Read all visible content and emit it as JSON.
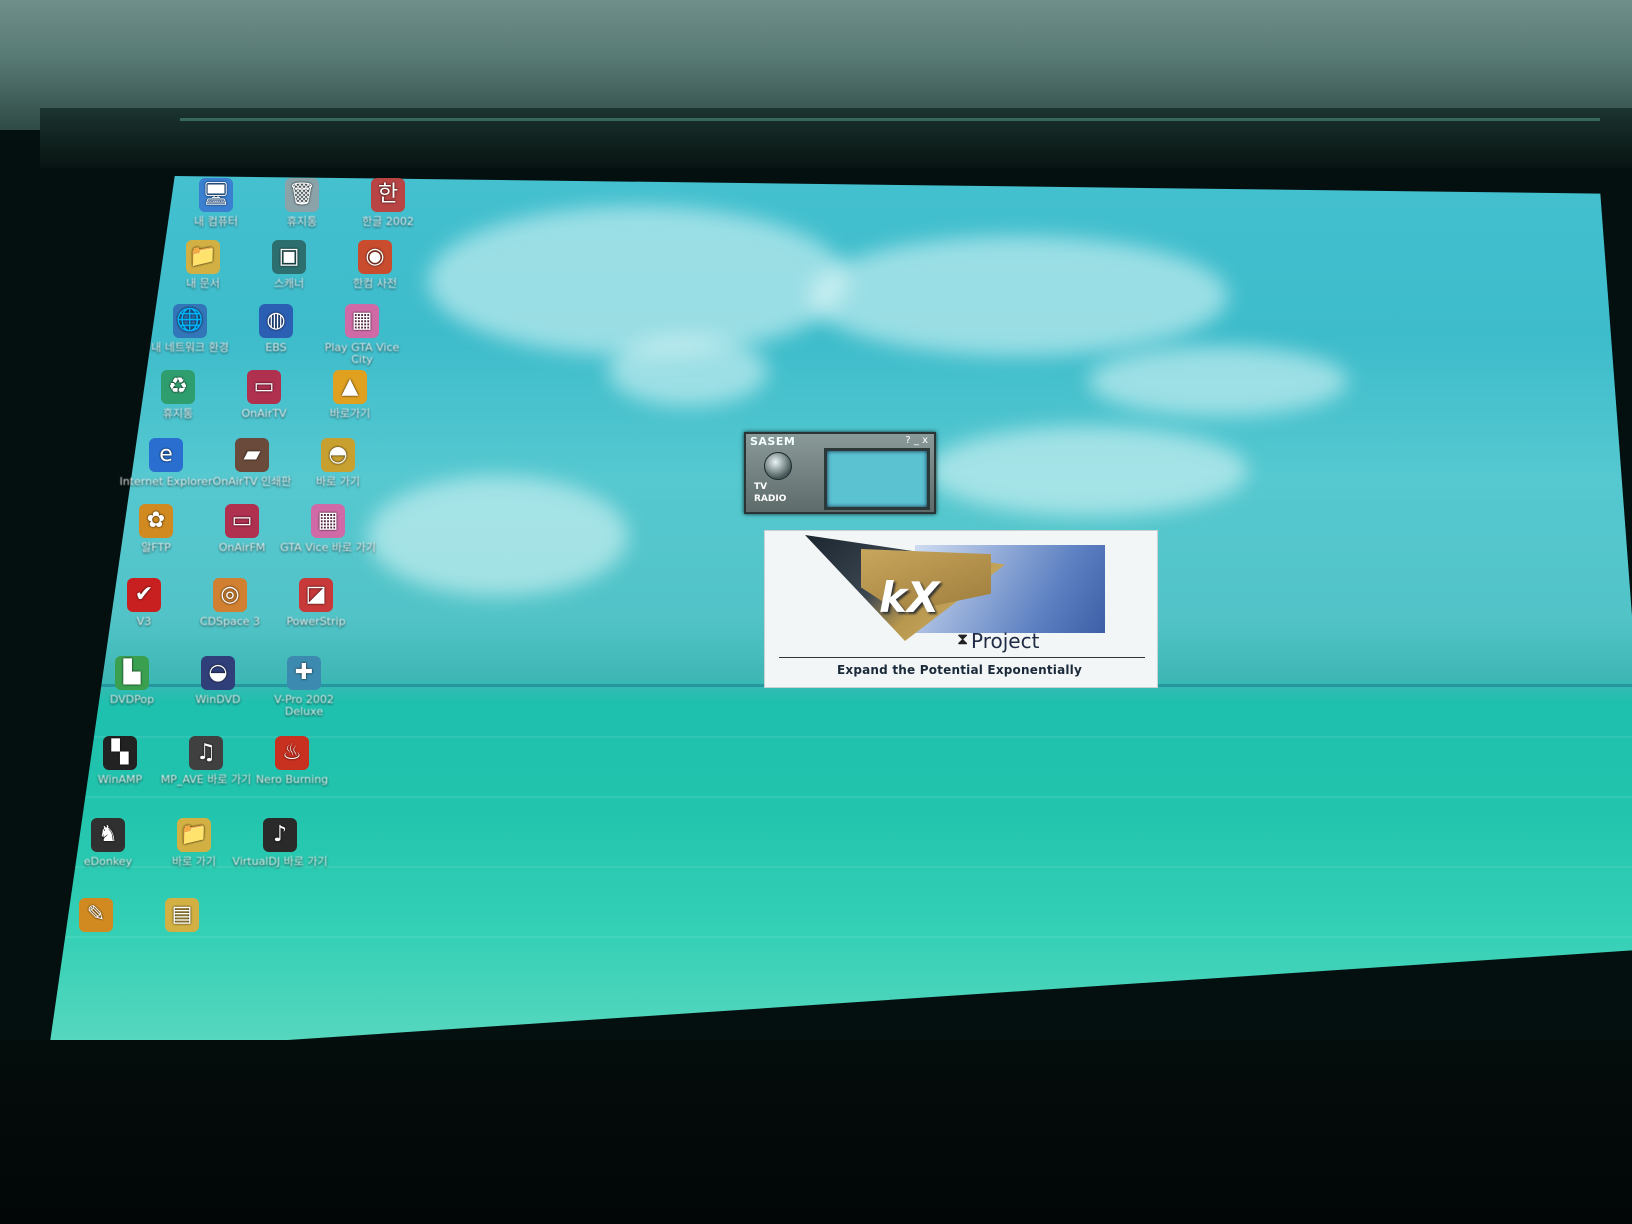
{
  "desktop": {
    "icons": [
      {
        "label": "내 컴퓨터",
        "icon": "my-computer-icon",
        "glyph": "🖥",
        "color": "#3a7fd0"
      },
      {
        "label": "휴지통",
        "icon": "recycle-bin-icon",
        "glyph": "🗑",
        "color": "#8aa2a8"
      },
      {
        "label": "한글 2002",
        "icon": "hangul-2002-icon",
        "glyph": "한",
        "color": "#b84444"
      },
      {
        "label": "내 문서",
        "icon": "my-documents-folder-icon",
        "glyph": "📁",
        "color": "#d2b043"
      },
      {
        "label": "스캐너",
        "icon": "scanner-icon",
        "glyph": "▣",
        "color": "#2d6f6f"
      },
      {
        "label": "한컴 사전",
        "icon": "hancom-dictionary-icon",
        "glyph": "◉",
        "color": "#c94c2f"
      },
      {
        "label": "내 네트워크 환경",
        "icon": "network-places-icon",
        "glyph": "🌐",
        "color": "#3275b8"
      },
      {
        "label": "EBS",
        "icon": "ebs-icon",
        "glyph": "◍",
        "color": "#2b5fb3"
      },
      {
        "label": "Play GTA Vice City",
        "icon": "gta-vice-city-icon",
        "glyph": "▦",
        "color": "#d06aa6"
      },
      {
        "label": "휴지통",
        "icon": "bin-icon",
        "glyph": "♻",
        "color": "#2f9e6e"
      },
      {
        "label": "OnAirTV",
        "icon": "onairtv-icon",
        "glyph": "▭",
        "color": "#b03050"
      },
      {
        "label": "바로가기",
        "icon": "shortcut-pizza-icon",
        "glyph": "▲",
        "color": "#e0a020"
      },
      {
        "label": "Internet Explorer",
        "icon": "internet-explorer-icon",
        "glyph": "e",
        "color": "#2a6fd0"
      },
      {
        "label": "OnAirTV 인쇄판",
        "icon": "onairtv-remote-icon",
        "glyph": "▰",
        "color": "#6a4a3a"
      },
      {
        "label": "바로 가기",
        "icon": "game-shortcut-icon",
        "glyph": "◓",
        "color": "#c8a030"
      },
      {
        "label": "알FTP",
        "icon": "ftp-icon",
        "glyph": "✿",
        "color": "#d08a20"
      },
      {
        "label": "OnAirFM",
        "icon": "onairfm-icon",
        "glyph": "▭",
        "color": "#b03050"
      },
      {
        "label": "GTA Vice 바로 가기",
        "icon": "gta-shortcut-icon",
        "glyph": "▦",
        "color": "#d06aa6"
      },
      {
        "label": "V3",
        "icon": "v3-antivirus-icon",
        "glyph": "✔",
        "color": "#c82020"
      },
      {
        "label": "CDSpace 3",
        "icon": "cdspace-icon",
        "glyph": "◎",
        "color": "#d08030"
      },
      {
        "label": "PowerStrip",
        "icon": "powerstrip-icon",
        "glyph": "◪",
        "color": "#c83a3a"
      },
      {
        "label": "DVDPop",
        "icon": "dvdpop-icon",
        "glyph": "▙",
        "color": "#3aa050"
      },
      {
        "label": "WinDVD",
        "icon": "windvd-icon",
        "glyph": "◒",
        "color": "#303f7a"
      },
      {
        "label": "V-Pro 2002 Deluxe",
        "icon": "vpro-icon",
        "glyph": "✚",
        "color": "#3c8ab0"
      },
      {
        "label": "WinAMP",
        "icon": "winamp-icon",
        "glyph": "▚",
        "color": "#222222"
      },
      {
        "label": "MP_AVE 바로 가기",
        "icon": "mp-ave-icon",
        "glyph": "♫",
        "color": "#404040"
      },
      {
        "label": "Nero Burning",
        "icon": "nero-icon",
        "glyph": "♨",
        "color": "#c83020"
      },
      {
        "label": "eDonkey",
        "icon": "edonkey-icon",
        "glyph": "♞",
        "color": "#303030"
      },
      {
        "label": "바로 가기",
        "icon": "folder-shortcut-icon",
        "glyph": "📁",
        "color": "#d2b043"
      },
      {
        "label": "VirtualDJ 바로 가기",
        "icon": "music-shortcut-icon",
        "glyph": "♪",
        "color": "#2a2a2a"
      },
      {
        "label": "",
        "icon": "pencil-icon",
        "glyph": "✎",
        "color": "#d08a20"
      },
      {
        "label": "",
        "icon": "folder-icon",
        "glyph": "▤",
        "color": "#d2b043"
      }
    ]
  },
  "tv_widget": {
    "title": "SASEM",
    "controls": "? _ x",
    "tv_label": "TV",
    "radio_label": "RADIO"
  },
  "splash": {
    "logo": "kX",
    "name": "Project",
    "tagline": "Expand the Potential Exponentially"
  }
}
